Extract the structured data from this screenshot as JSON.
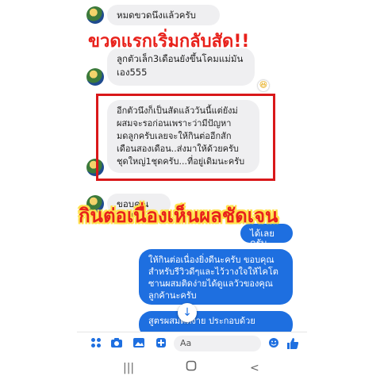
{
  "messages": {
    "m1": "หมดขวดนึงแล้วครับ",
    "m2": "ลูกตัวเล็ก3เดือนยังขึ้นโคมแม่มันเอง555",
    "m3": "อีกตัวนึงก็เป็นสัดแล้ววันนี้แต่ยังม่ผสมจะรอก่อนเพราะว่ามีปัญหามดลูกครับเลยจะให้กินต่ออีกสักเดือนสองเดือน..ส่งมาให้ด้วยครับชุดใหญ่1ชุดครับ...ที่อยู่เดิมนะครับ",
    "m4": "ขอบคุณครับ",
    "m5": "ได้เลยครับ",
    "m6": "ให้กินต่อเนื่องยิ่งดีนะครับ ขอบคุณสำหรับรีวิวดีๆและไว้วางใจให้ไคโตซานผสมติดง่ายได้ดูแลวัวของคุณลูกค้านะครับ",
    "m7": "สูตรผสมติดง่าย ประกอบด้วย"
  },
  "overlay": {
    "headline_top": "ขวดแรกเริ่มกลับสัด!!",
    "headline_mid": "กินต่อเนื่องเห็นผลชัดเจน"
  },
  "composer": {
    "placeholder": "Aa",
    "icons": [
      "apps-icon",
      "camera-icon",
      "image-icon",
      "gif-icon",
      "emoji-icon",
      "like-icon"
    ]
  },
  "reactions": {
    "r1": "😆"
  },
  "colors": {
    "outgoing": "#1e6fe0",
    "incoming": "#efeff1",
    "highlight": "#d9181a"
  }
}
